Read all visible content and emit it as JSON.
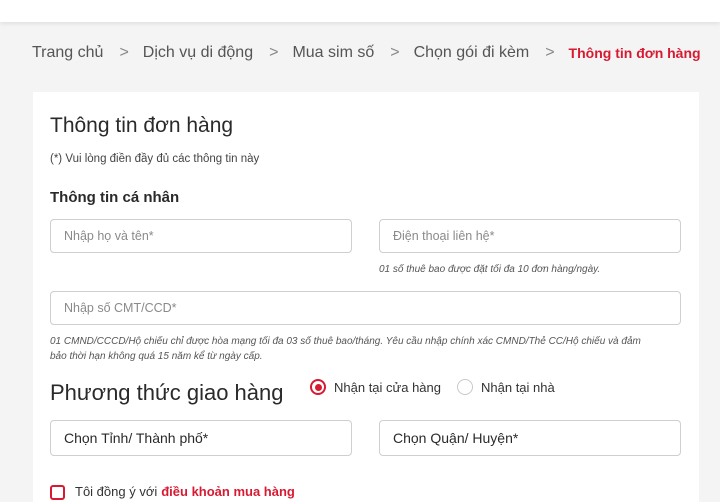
{
  "breadcrumb": {
    "items": [
      "Trang chủ",
      "Dịch vụ di động",
      "Mua sim số",
      "Chọn gói đi kèm",
      "Thông tin đơn hàng"
    ],
    "separator": ">"
  },
  "form": {
    "title": "Thông tin đơn hàng",
    "required_note": "(*) Vui lòng điền đầy đủ các thông tin này",
    "personal_section": "Thông tin cá nhân",
    "name_placeholder": "Nhập họ và tên*",
    "phone_placeholder": "Điện thoại liên hệ*",
    "phone_hint": "01 số thuê bao được đặt tối đa 10 đơn hàng/ngày.",
    "id_placeholder": "Nhập số CMT/CCD*",
    "id_hint_1": "01 CMND/CCCD/Hộ chiếu chỉ được hòa mạng tối đa 03 số thuê bao/tháng. Yêu cầu nhập chính xác CMND/Thẻ CC/Hộ chiếu và đảm",
    "id_hint_2": "bảo thời hạn không quá 15 năm kể từ ngày cấp."
  },
  "delivery": {
    "title": "Phương thức giao hàng",
    "options": [
      "Nhận tại cửa hàng",
      "Nhận tại nhà"
    ],
    "selected": "Nhận tại cửa hàng",
    "province_label": "Chọn Tỉnh/ Thành phố*",
    "district_label": "Chọn Quận/ Huyện*"
  },
  "agreement": {
    "text": "Tôi đồng ý với",
    "link": "điều khoản mua hàng"
  },
  "colors": {
    "accent": "#d71a32",
    "background": "#f4f4f4"
  }
}
